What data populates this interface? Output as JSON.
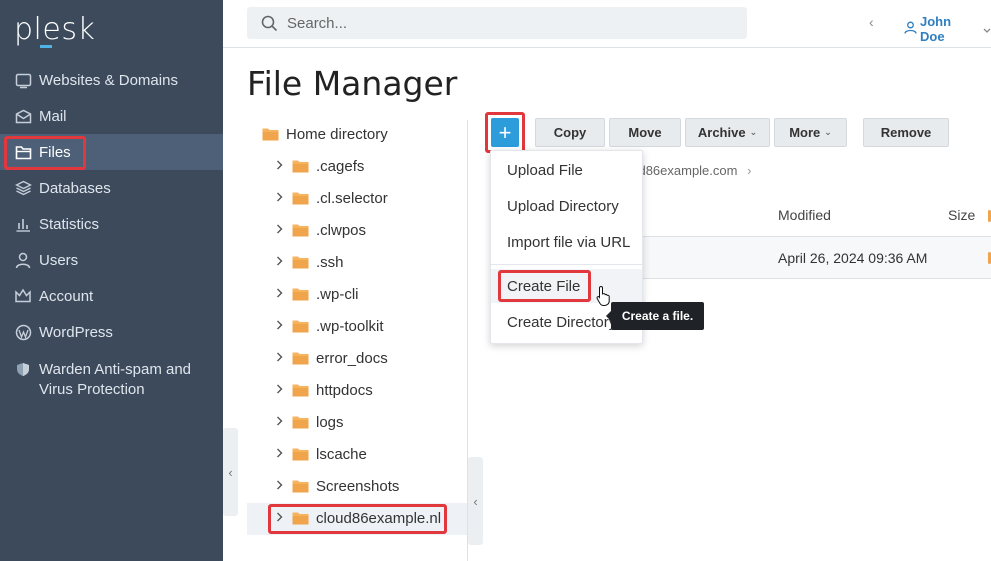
{
  "brand": {
    "logo": "plesk",
    "accent": "#4fb3e8"
  },
  "sidebar": {
    "items": [
      {
        "label": "Websites & Domains",
        "icon": "globe-icon"
      },
      {
        "label": "Mail",
        "icon": "mail-icon"
      },
      {
        "label": "Files",
        "icon": "folder-icon",
        "active": true
      },
      {
        "label": "Databases",
        "icon": "database-icon"
      },
      {
        "label": "Statistics",
        "icon": "bar-chart-icon"
      },
      {
        "label": "Users",
        "icon": "user-icon"
      },
      {
        "label": "Account",
        "icon": "account-icon"
      },
      {
        "label": "WordPress",
        "icon": "wordpress-icon"
      },
      {
        "label": "Warden Anti-spam and Virus Protection",
        "line1": "Warden Anti-spam and",
        "line2": "Virus Protection",
        "icon": "shield-icon"
      }
    ]
  },
  "header": {
    "search_placeholder": "Search...",
    "back_glyph": "‹",
    "user_name": "John Doe"
  },
  "page": {
    "title": "File Manager"
  },
  "tree": {
    "root": "Home directory",
    "items": [
      ".cagefs",
      ".cl.selector",
      ".clwpos",
      ".ssh",
      ".wp-cli",
      ".wp-toolkit",
      "error_docs",
      "httpdocs",
      "logs",
      "lscache",
      "Screenshots",
      "cloud86example.nl"
    ],
    "selected": "cloud86example.nl"
  },
  "toolbar": {
    "add_label": "+",
    "copy": "Copy",
    "move": "Move",
    "archive": "Archive",
    "more": "More",
    "remove": "Remove"
  },
  "breadcrumb": {
    "path": "oud86example.com",
    "sep": "›"
  },
  "table": {
    "headers": {
      "modified": "Modified",
      "size": "Size"
    },
    "rows": [
      {
        "modified": "April 26, 2024 09:36 AM"
      }
    ]
  },
  "add_menu": {
    "items": [
      "Upload File",
      "Upload Directory",
      "Import file via URL",
      "Create File",
      "Create Directory"
    ],
    "hovered": "Create File",
    "tooltip": "Create a file."
  },
  "colors": {
    "sidebar": "#3c4a5c",
    "sidebar_active": "#4d6077",
    "primary": "#2d9cdb",
    "highlight": "#e0383c",
    "folder": "#f0a44b"
  }
}
